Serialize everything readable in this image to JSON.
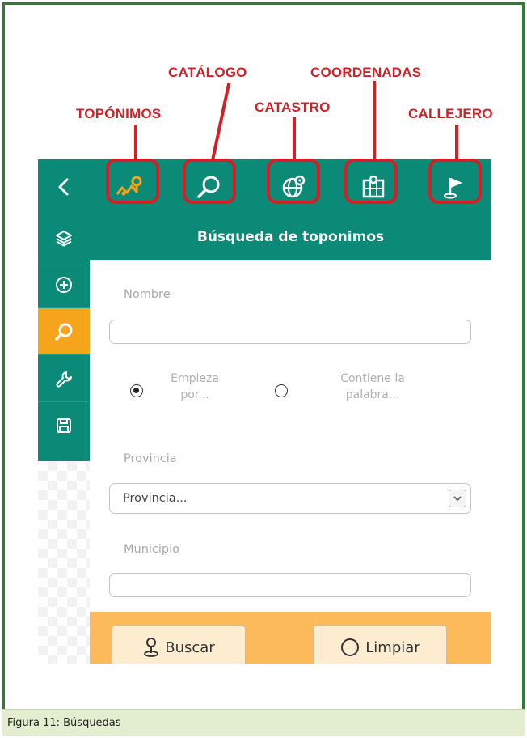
{
  "callouts": {
    "toponimos": "TOPÓNIMOS",
    "catalogo": "CATÁLOGO",
    "catastro": "CATASTRO",
    "coordenadas": "COORDENADAS",
    "callejero": "CALLEJERO"
  },
  "toolbar": {
    "tools": [
      "map-pins-icon",
      "magnifier-icon",
      "globe-pin-icon",
      "map-grid-icon",
      "flag-icon"
    ]
  },
  "sidebar": {
    "items": [
      "layers-icon",
      "add-circle-icon",
      "search-icon",
      "wrench-icon",
      "save-icon"
    ],
    "active_index": 2
  },
  "panel": {
    "title": "Búsqueda de toponimos",
    "nombre_label": "Nombre",
    "nombre_value": "",
    "radio_options": [
      "Empieza por...",
      "Contiene la palabra..."
    ],
    "radio_lines": [
      [
        "Empieza",
        "por..."
      ],
      [
        "Contiene la",
        "palabra..."
      ]
    ],
    "radio_selected": 0,
    "provincia_label": "Provincia",
    "provincia_selected": "Provincia...",
    "municipio_label": "Municipio",
    "municipio_value": ""
  },
  "buttons": {
    "buscar": "Buscar",
    "limpiar": "Limpiar"
  },
  "caption": "Figura 11: Búsquedas",
  "colors": {
    "primary_teal": "#0c8a78",
    "accent_orange": "#f7a41d",
    "footer_orange": "#fcba5a",
    "callout_red": "#d32027",
    "frame_green": "#2e7d32",
    "caption_bg": "#e3edcf"
  }
}
